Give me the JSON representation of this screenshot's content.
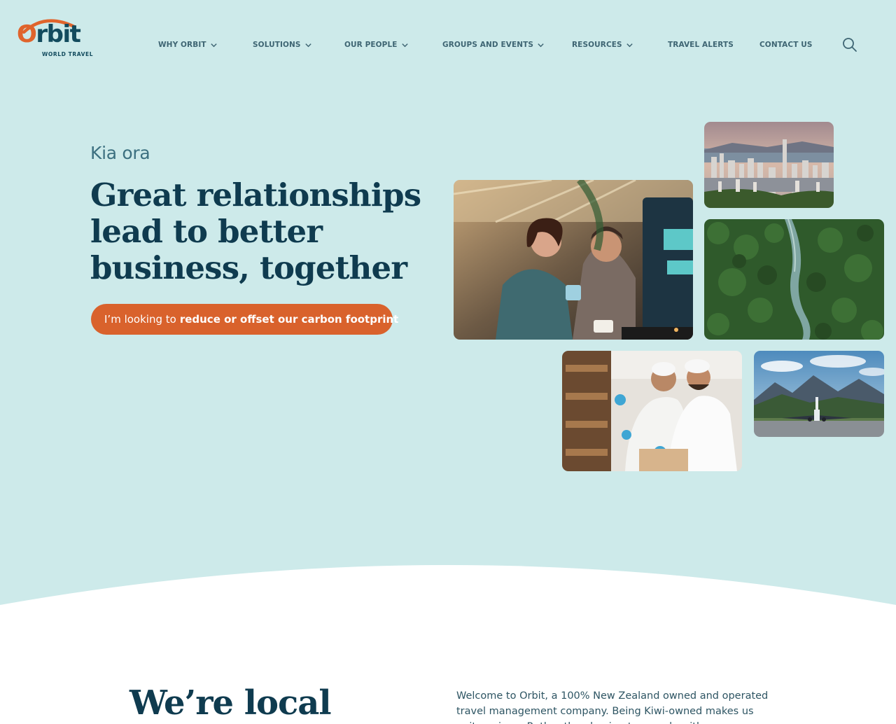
{
  "brand": {
    "name": "Orbit",
    "tagline": "WORLD TRAVEL",
    "colors": {
      "primary": "#0f3b4f",
      "accent": "#d9622c",
      "hero_bg": "#cdeaea"
    }
  },
  "nav": {
    "items": [
      {
        "label": "WHY ORBIT",
        "has_dropdown": true
      },
      {
        "label": "SOLUTIONS",
        "has_dropdown": true
      },
      {
        "label": "OUR PEOPLE",
        "has_dropdown": true
      },
      {
        "label": "GROUPS AND EVENTS",
        "has_dropdown": true
      },
      {
        "label": "RESOURCES",
        "has_dropdown": true
      },
      {
        "label": "TRAVEL ALERTS",
        "has_dropdown": false
      },
      {
        "label": "CONTACT US",
        "has_dropdown": false
      }
    ],
    "search_icon": "search-icon"
  },
  "hero": {
    "greeting": "Kia ora",
    "headline_lines": [
      "Great relationships",
      "lead to better",
      "business, together"
    ],
    "cta": {
      "lead": "I’m looking to",
      "strong": "reduce or offset our carbon footprint",
      "icon": "chevron-down-icon"
    },
    "photos": [
      {
        "name": "office-photo"
      },
      {
        "name": "city-skyline-photo"
      },
      {
        "name": "forest-river-photo"
      },
      {
        "name": "factory-workers-photo"
      },
      {
        "name": "airplane-mountains-photo"
      }
    ]
  },
  "intro": {
    "title": "We’re local",
    "body": "Welcome to Orbit, a 100% New Zealand owned and operated travel management company. Being Kiwi-owned makes us quite unique. Rather than having to comply with an international"
  }
}
